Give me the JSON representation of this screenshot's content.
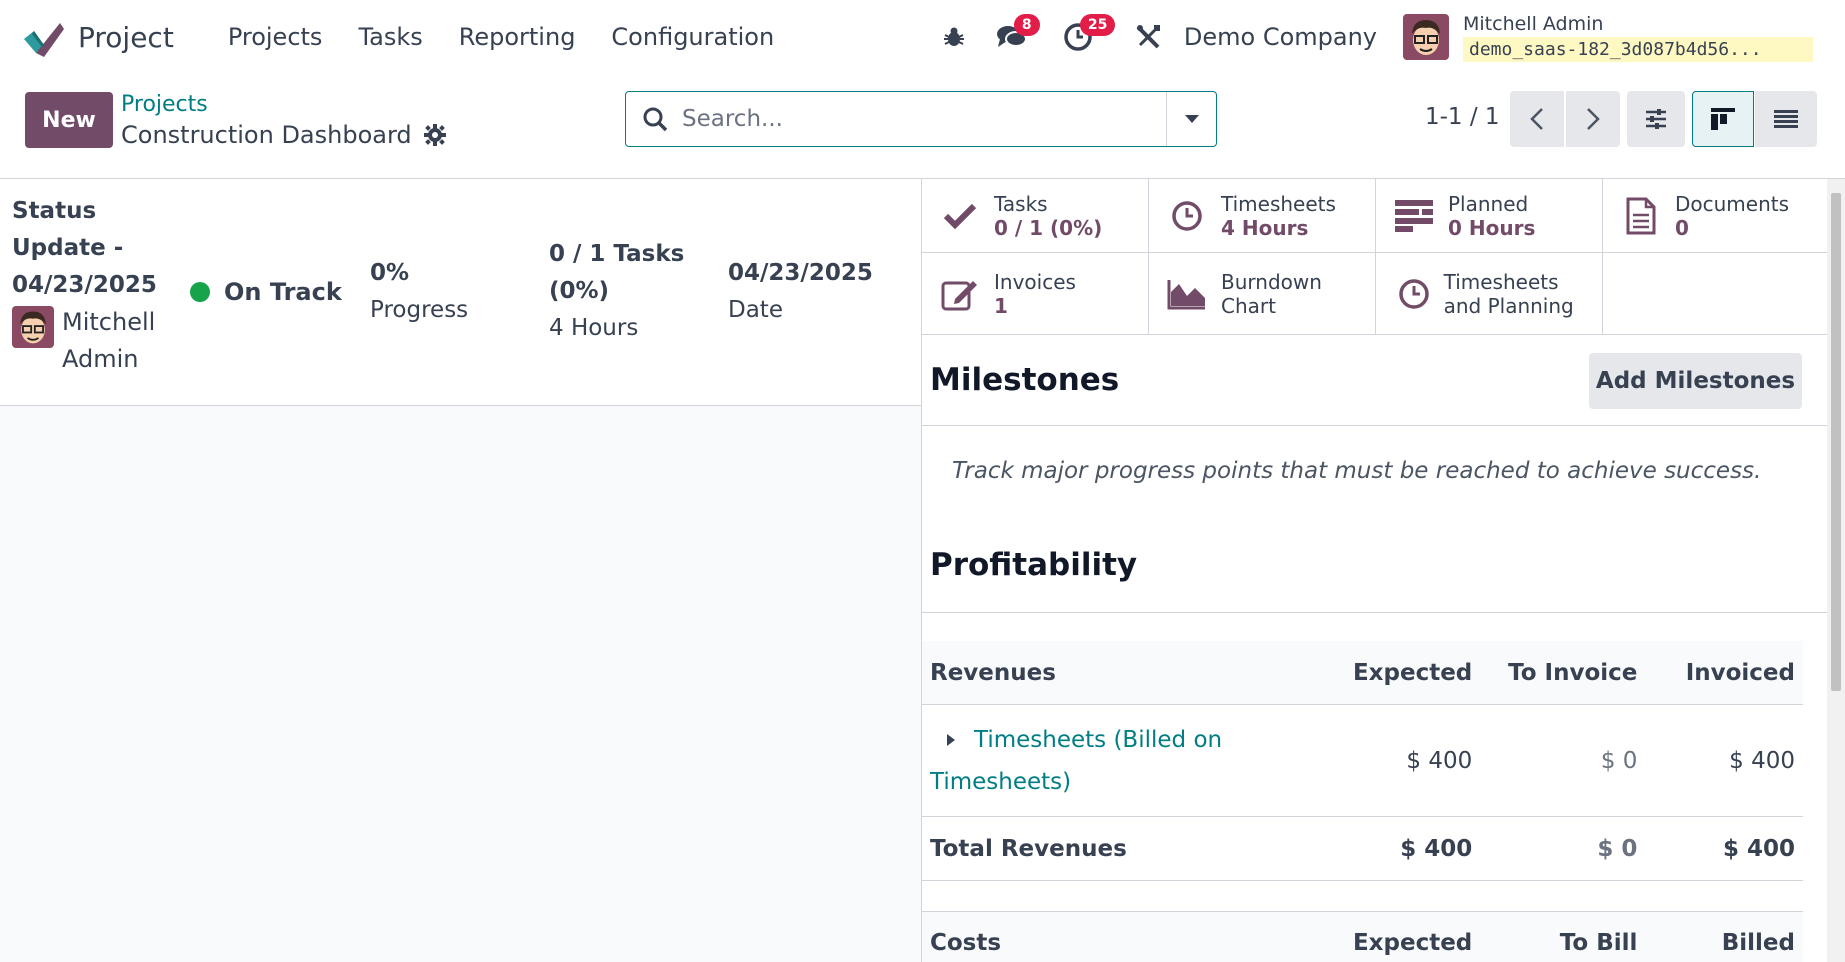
{
  "app": {
    "name": "Project"
  },
  "menu": [
    "Projects",
    "Tasks",
    "Reporting",
    "Configuration"
  ],
  "systray": {
    "messages_count": "8",
    "activities_count": "25",
    "company": "Demo Company",
    "user_name": "Mitchell Admin",
    "database": "demo_saas-182_3d087b4d56..."
  },
  "control": {
    "new_label": "New",
    "breadcrumb_parent": "Projects",
    "breadcrumb_current": "Construction Dashboard",
    "search_placeholder": "Search...",
    "pager": "1-1 / 1"
  },
  "status_update": {
    "title": "Status Update - 04/23/2025",
    "user": "Mitchell Admin",
    "status": "On Track",
    "status_color": "#16a34a",
    "progress_value": "0%",
    "progress_label": "Progress",
    "tasks_value": "0 / 1 Tasks (0%)",
    "hours_label": "4 Hours",
    "date_value": "04/23/2025",
    "date_label": "Date"
  },
  "stat_buttons": {
    "tasks": {
      "label": "Tasks",
      "value": "0 / 1 (0%)"
    },
    "timesheets": {
      "label": "Timesheets",
      "value": "4 Hours"
    },
    "planned": {
      "label": "Planned",
      "value": "0 Hours"
    },
    "documents": {
      "label": "Documents",
      "value": "0"
    },
    "invoices": {
      "label": "Invoices",
      "value": "1"
    },
    "burndown": {
      "label": "Burndown Chart"
    },
    "timesheets_planning": {
      "label": "Timesheets and Planning"
    }
  },
  "milestones": {
    "title": "Milestones",
    "add_label": "Add Milestones",
    "help": "Track major progress points that must be reached to achieve success."
  },
  "profitability": {
    "title": "Profitability",
    "revenues_header": [
      "Revenues",
      "Expected",
      "To Invoice",
      "Invoiced"
    ],
    "revenue_rows": [
      {
        "name": "Timesheets (Billed on Timesheets)",
        "expected": "$ 400",
        "to_invoice": "$ 0",
        "invoiced": "$ 400"
      }
    ],
    "total_revenues": {
      "name": "Total Revenues",
      "expected": "$ 400",
      "to_invoice": "$ 0",
      "invoiced": "$ 400"
    },
    "costs_header": [
      "Costs",
      "Expected",
      "To Bill",
      "Billed"
    ]
  },
  "colors": {
    "brand": "#714b67",
    "link": "#017e84",
    "badge": "#e11d48"
  }
}
